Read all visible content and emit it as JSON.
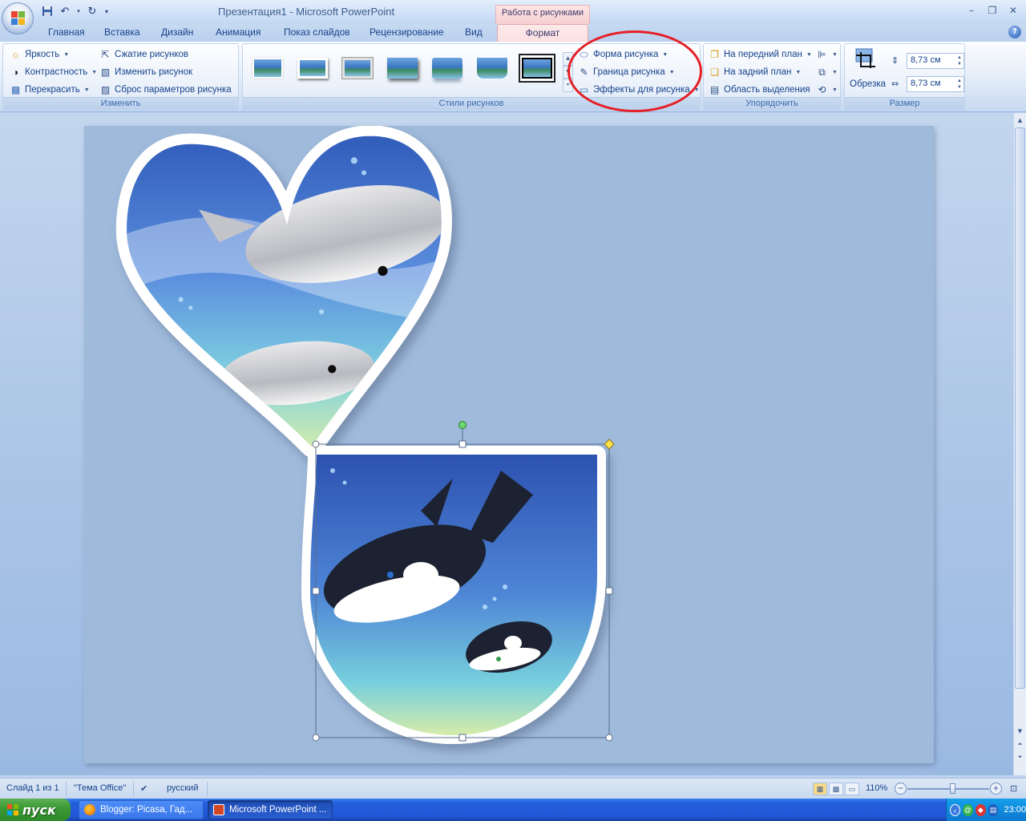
{
  "window": {
    "title": "Презентация1  -  Microsoft PowerPoint",
    "context_tab_title": "Работа с рисунками"
  },
  "tabs": [
    "Главная",
    "Вставка",
    "Дизайн",
    "Анимация",
    "Показ слайдов",
    "Рецензирование",
    "Вид"
  ],
  "active_tab": "Формат",
  "ribbon": {
    "adjust": {
      "label": "Изменить",
      "brightness": "Яркость",
      "contrast": "Контрастность",
      "recolor": "Перекрасить",
      "compress": "Сжатие рисунков",
      "change": "Изменить рисунок",
      "reset": "Сброс параметров рисунка"
    },
    "styles": {
      "label": "Стили рисунков",
      "shape": "Форма рисунка",
      "border": "Граница рисунка",
      "effects": "Эффекты для рисунка"
    },
    "arrange": {
      "label": "Упорядочить",
      "front": "На передний план",
      "back": "На задний план",
      "selection": "Область выделения"
    },
    "size": {
      "label": "Размер",
      "crop": "Обрезка",
      "height": "8,73 см",
      "width": "8,73 см"
    }
  },
  "statusbar": {
    "slide": "Слайд 1 из 1",
    "theme": "\"Тема Office\"",
    "language": "русский",
    "zoom": "110%",
    "zoom_fraction": 0.55
  },
  "taskbar": {
    "start": "пуск",
    "task1": "Blogger: Picasa, Гад...",
    "task2": "Microsoft PowerPoint ...",
    "clock": "23:00"
  },
  "colors": {
    "annotation": "#e51e25",
    "ribbon_text": "#15428b",
    "context_tab": "#f6cfd1"
  }
}
